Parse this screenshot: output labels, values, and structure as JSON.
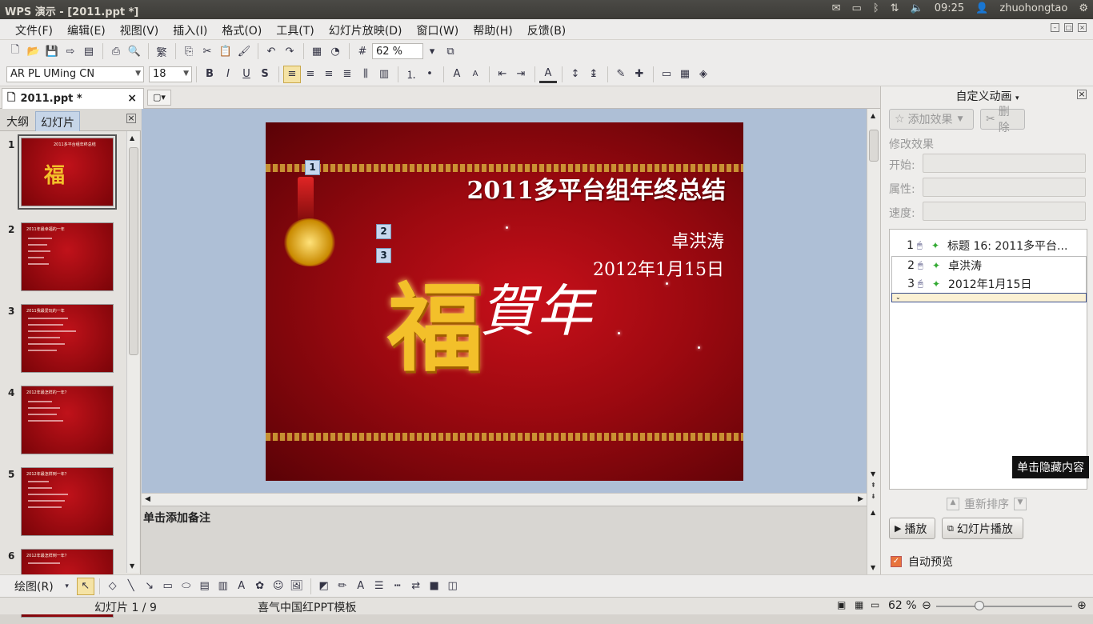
{
  "system": {
    "window_title": "WPS 演示 - [2011.ppt *]",
    "time": "09:25",
    "user": "zhuohongtao"
  },
  "menu": [
    "文件(F)",
    "编辑(E)",
    "视图(V)",
    "插入(I)",
    "格式(O)",
    "工具(T)",
    "幻灯片放映(D)",
    "窗口(W)",
    "帮助(H)",
    "反馈(B)"
  ],
  "toolbar": {
    "zoom": "62 %",
    "font_name": "AR PL UMing CN",
    "font_size": "18"
  },
  "document_tab": {
    "label": "2011.ppt *"
  },
  "left_panel": {
    "tabs": [
      "大纲",
      "幻灯片"
    ],
    "slides": [
      {
        "num": "1",
        "title": "2011多平台组年终总结"
      },
      {
        "num": "2",
        "title": "2011年最幸福的一年"
      },
      {
        "num": "3",
        "title": "2011我最爱玩的一年"
      },
      {
        "num": "4",
        "title": "2012年最怎样的一年？"
      },
      {
        "num": "5",
        "title": "2012年最怎样到一年？"
      },
      {
        "num": "6",
        "title": "2012年最怎样到一年？"
      }
    ]
  },
  "slide": {
    "title": "2011多平台组年终总结",
    "author": "卓洪涛",
    "date": "2012年1月15日",
    "calligraphy_main": "福",
    "calligraphy_sub": "賀年",
    "anim_tags": [
      "1",
      "2",
      "3"
    ]
  },
  "notes": {
    "placeholder": "单击添加备注"
  },
  "task_pane": {
    "title": "自定义动画",
    "add_effect": "添加效果",
    "delete": "删除",
    "modify_effect": "修改效果",
    "start_label": "开始:",
    "property_label": "属性:",
    "speed_label": "速度:",
    "effects": [
      {
        "num": "1",
        "label": "标题 16: 2011多平台..."
      },
      {
        "num": "2",
        "label": "卓洪涛"
      },
      {
        "num": "3",
        "label": "2012年1月15日"
      }
    ],
    "tooltip": "单击隐藏内容",
    "reorder": "重新排序",
    "play": "播放",
    "slideshow": "幻灯片播放",
    "auto_preview": "自动预览"
  },
  "drawbar": {
    "draw_label": "绘图(R)"
  },
  "status": {
    "slide_position": "幻灯片 1 / 9",
    "template": "喜气中国红PPT模板",
    "zoom": "62 %"
  }
}
